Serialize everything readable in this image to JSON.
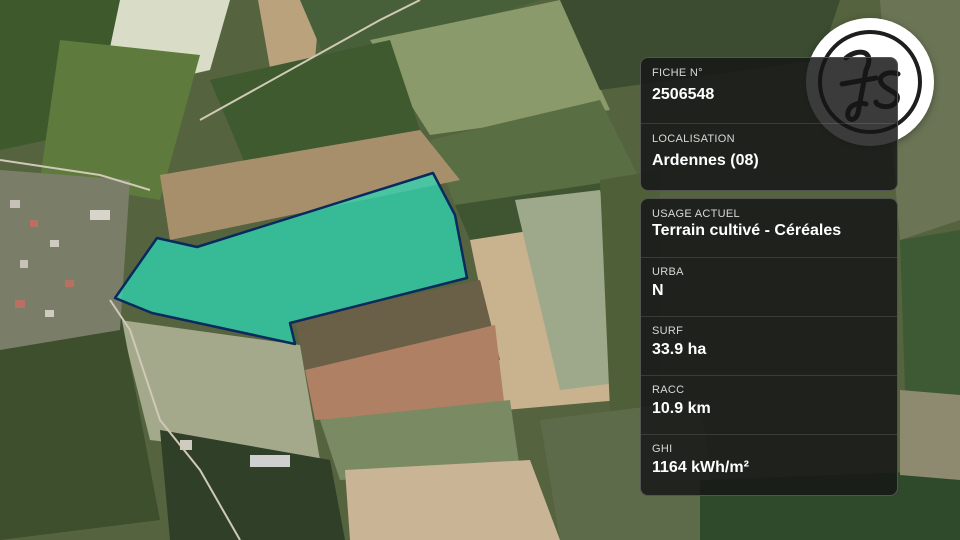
{
  "parcel": {
    "fiche_label": "FICHE N°",
    "fiche_value": "2506548",
    "localisation_label": "LOCALISATION",
    "localisation_value": "Ardennes (08)"
  },
  "details": {
    "usage_label": "USAGE ACTUEL",
    "usage_value": "Terrain cultivé - Céréales",
    "urba_label": "URBA",
    "urba_value": "N",
    "surf_label": "SURF",
    "surf_value": "33.9 ha",
    "racc_label": "RACC",
    "racc_value": "10.9 km",
    "ghi_label": "GHI",
    "ghi_value": "1164 kWh/m²"
  },
  "logo": {
    "icon": "fs-monogram-logo"
  },
  "colors": {
    "parcel_fill": "#2fd3b0",
    "parcel_outline": "#0a2a5e",
    "panel_bg": "#161616"
  }
}
